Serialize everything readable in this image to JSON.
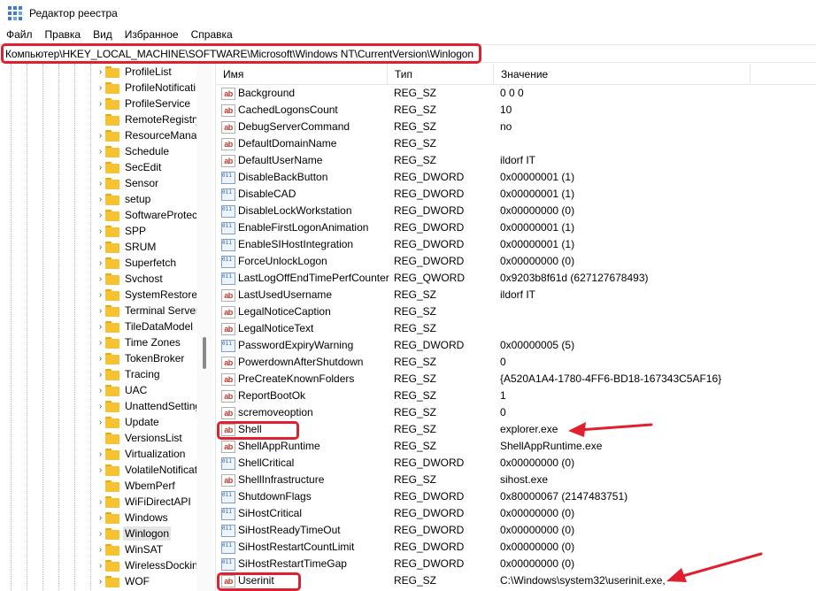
{
  "window": {
    "title": "Редактор реестра"
  },
  "menu": [
    "Файл",
    "Правка",
    "Вид",
    "Избранное",
    "Справка"
  ],
  "address": "Компьютер\\HKEY_LOCAL_MACHINE\\SOFTWARE\\Microsoft\\Windows NT\\CurrentVersion\\Winlogon",
  "colors": {
    "highlight": "#e0202e",
    "folder": "#f6c232",
    "selection": "#e5e5e5"
  },
  "tree": [
    {
      "label": "ProfileList",
      "expandable": true
    },
    {
      "label": "ProfileNotificati",
      "expandable": true
    },
    {
      "label": "ProfileService",
      "expandable": true
    },
    {
      "label": "RemoteRegistry",
      "expandable": false
    },
    {
      "label": "ResourceManag",
      "expandable": true
    },
    {
      "label": "Schedule",
      "expandable": true
    },
    {
      "label": "SecEdit",
      "expandable": true
    },
    {
      "label": "Sensor",
      "expandable": true
    },
    {
      "label": "setup",
      "expandable": true
    },
    {
      "label": "SoftwareProtect",
      "expandable": true
    },
    {
      "label": "SPP",
      "expandable": true
    },
    {
      "label": "SRUM",
      "expandable": true
    },
    {
      "label": "Superfetch",
      "expandable": true
    },
    {
      "label": "Svchost",
      "expandable": true
    },
    {
      "label": "SystemRestore",
      "expandable": true
    },
    {
      "label": "Terminal Server",
      "expandable": true
    },
    {
      "label": "TileDataModel",
      "expandable": true
    },
    {
      "label": "Time Zones",
      "expandable": true
    },
    {
      "label": "TokenBroker",
      "expandable": true
    },
    {
      "label": "Tracing",
      "expandable": true
    },
    {
      "label": "UAC",
      "expandable": true
    },
    {
      "label": "UnattendSetting",
      "expandable": true
    },
    {
      "label": "Update",
      "expandable": true
    },
    {
      "label": "VersionsList",
      "expandable": false
    },
    {
      "label": "Virtualization",
      "expandable": true
    },
    {
      "label": "VolatileNotificat",
      "expandable": true
    },
    {
      "label": "WbemPerf",
      "expandable": false
    },
    {
      "label": "WiFiDirectAPI",
      "expandable": true
    },
    {
      "label": "Windows",
      "expandable": true
    },
    {
      "label": "Winlogon",
      "expandable": true,
      "selected": true
    },
    {
      "label": "WinSAT",
      "expandable": true
    },
    {
      "label": "WirelessDocking",
      "expandable": true
    },
    {
      "label": "WOF",
      "expandable": true
    }
  ],
  "columns": {
    "name": "Имя",
    "type": "Тип",
    "value": "Значение"
  },
  "rows": [
    {
      "name": "Background",
      "type": "REG_SZ",
      "value": "0 0 0",
      "icon": "string-value-icon"
    },
    {
      "name": "CachedLogonsCount",
      "type": "REG_SZ",
      "value": "10",
      "icon": "string-value-icon"
    },
    {
      "name": "DebugServerCommand",
      "type": "REG_SZ",
      "value": "no",
      "icon": "string-value-icon"
    },
    {
      "name": "DefaultDomainName",
      "type": "REG_SZ",
      "value": "",
      "icon": "string-value-icon"
    },
    {
      "name": "DefaultUserName",
      "type": "REG_SZ",
      "value": "ildorf IT",
      "icon": "string-value-icon"
    },
    {
      "name": "DisableBackButton",
      "type": "REG_DWORD",
      "value": "0x00000001 (1)",
      "icon": "binary-value-icon"
    },
    {
      "name": "DisableCAD",
      "type": "REG_DWORD",
      "value": "0x00000001 (1)",
      "icon": "binary-value-icon"
    },
    {
      "name": "DisableLockWorkstation",
      "type": "REG_DWORD",
      "value": "0x00000000 (0)",
      "icon": "binary-value-icon"
    },
    {
      "name": "EnableFirstLogonAnimation",
      "type": "REG_DWORD",
      "value": "0x00000001 (1)",
      "icon": "binary-value-icon"
    },
    {
      "name": "EnableSIHostIntegration",
      "type": "REG_DWORD",
      "value": "0x00000001 (1)",
      "icon": "binary-value-icon"
    },
    {
      "name": "ForceUnlockLogon",
      "type": "REG_DWORD",
      "value": "0x00000000 (0)",
      "icon": "binary-value-icon"
    },
    {
      "name": "LastLogOffEndTimePerfCounter",
      "type": "REG_QWORD",
      "value": "0x9203b8f61d (627127678493)",
      "icon": "binary-value-icon"
    },
    {
      "name": "LastUsedUsername",
      "type": "REG_SZ",
      "value": "ildorf IT",
      "icon": "string-value-icon"
    },
    {
      "name": "LegalNoticeCaption",
      "type": "REG_SZ",
      "value": "",
      "icon": "string-value-icon"
    },
    {
      "name": "LegalNoticeText",
      "type": "REG_SZ",
      "value": "",
      "icon": "string-value-icon"
    },
    {
      "name": "PasswordExpiryWarning",
      "type": "REG_DWORD",
      "value": "0x00000005 (5)",
      "icon": "binary-value-icon"
    },
    {
      "name": "PowerdownAfterShutdown",
      "type": "REG_SZ",
      "value": "0",
      "icon": "string-value-icon"
    },
    {
      "name": "PreCreateKnownFolders",
      "type": "REG_SZ",
      "value": "{A520A1A4-1780-4FF6-BD18-167343C5AF16}",
      "icon": "string-value-icon"
    },
    {
      "name": "ReportBootOk",
      "type": "REG_SZ",
      "value": "1",
      "icon": "string-value-icon"
    },
    {
      "name": "scremoveoption",
      "type": "REG_SZ",
      "value": "0",
      "icon": "string-value-icon"
    },
    {
      "name": "Shell",
      "type": "REG_SZ",
      "value": "explorer.exe",
      "icon": "string-value-icon"
    },
    {
      "name": "ShellAppRuntime",
      "type": "REG_SZ",
      "value": "ShellAppRuntime.exe",
      "icon": "string-value-icon"
    },
    {
      "name": "ShellCritical",
      "type": "REG_DWORD",
      "value": "0x00000000 (0)",
      "icon": "binary-value-icon"
    },
    {
      "name": "ShellInfrastructure",
      "type": "REG_SZ",
      "value": "sihost.exe",
      "icon": "string-value-icon"
    },
    {
      "name": "ShutdownFlags",
      "type": "REG_DWORD",
      "value": "0x80000067 (2147483751)",
      "icon": "binary-value-icon"
    },
    {
      "name": "SiHostCritical",
      "type": "REG_DWORD",
      "value": "0x00000000 (0)",
      "icon": "binary-value-icon"
    },
    {
      "name": "SiHostReadyTimeOut",
      "type": "REG_DWORD",
      "value": "0x00000000 (0)",
      "icon": "binary-value-icon"
    },
    {
      "name": "SiHostRestartCountLimit",
      "type": "REG_DWORD",
      "value": "0x00000000 (0)",
      "icon": "binary-value-icon"
    },
    {
      "name": "SiHostRestartTimeGap",
      "type": "REG_DWORD",
      "value": "0x00000000 (0)",
      "icon": "binary-value-icon"
    },
    {
      "name": "Userinit",
      "type": "REG_SZ",
      "value": "C:\\Windows\\system32\\userinit.exe,",
      "icon": "string-value-icon"
    }
  ],
  "annotations": [
    "address-highlight",
    "shell-highlight",
    "userinit-highlight",
    "shell-arrow",
    "userinit-arrow"
  ]
}
